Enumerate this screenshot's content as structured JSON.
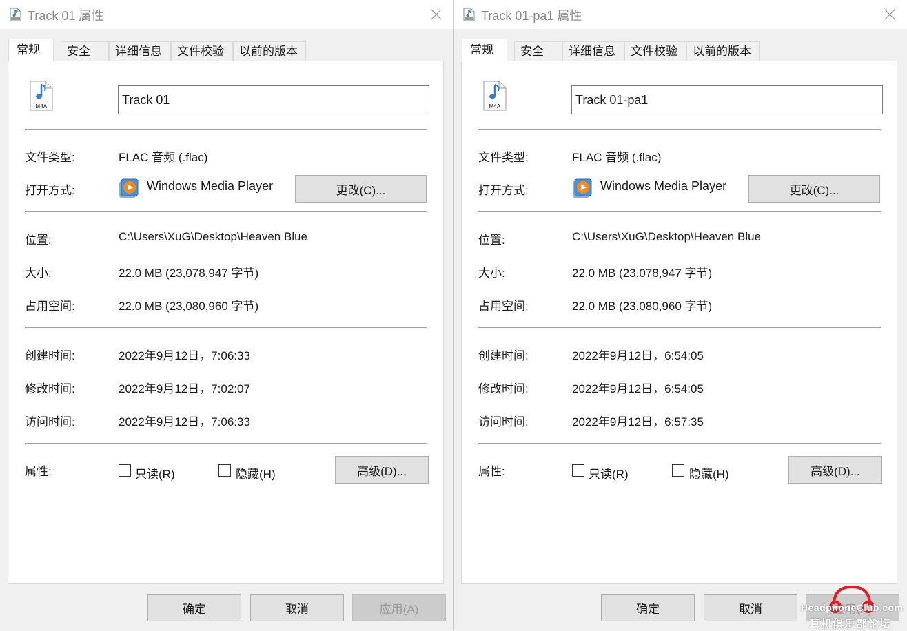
{
  "colors": {
    "watermark_red": "#e31b23",
    "disabled_text": "#9a9a9a"
  },
  "left": {
    "title": "Track 01 属性",
    "tabs": [
      "常规",
      "安全",
      "详细信息",
      "文件校验",
      "以前的版本"
    ],
    "name": "Track 01",
    "file_type_label": "文件类型:",
    "file_type": "FLAC 音频 (.flac)",
    "open_with_label": "打开方式:",
    "open_with_app": "Windows Media Player",
    "change_button": "更改(C)...",
    "location_label": "位置:",
    "location": "C:\\Users\\XuG\\Desktop\\Heaven Blue",
    "size_label": "大小:",
    "size": "22.0 MB (23,078,947 字节)",
    "disk_label": "占用空间:",
    "disk": "22.0 MB (23,080,960 字节)",
    "created_label": "创建时间:",
    "created": "2022年9月12日，7:06:33",
    "modified_label": "修改时间:",
    "modified": "2022年9月12日，7:02:07",
    "accessed_label": "访问时间:",
    "accessed": "2022年9月12日，7:06:33",
    "attributes_label": "属性:",
    "readonly_label": "只读(R)",
    "hidden_label": "隐藏(H)",
    "advanced_button": "高级(D)...",
    "ok_button": "确定",
    "cancel_button": "取消",
    "apply_button": "应用(A)"
  },
  "right": {
    "title": "Track 01-pa1 属性",
    "tabs": [
      "常规",
      "安全",
      "详细信息",
      "文件校验",
      "以前的版本"
    ],
    "name": "Track 01-pa1",
    "file_type_label": "文件类型:",
    "file_type": "FLAC 音频 (.flac)",
    "open_with_label": "打开方式:",
    "open_with_app": "Windows Media Player",
    "change_button": "更改(C)...",
    "location_label": "位置:",
    "location": "C:\\Users\\XuG\\Desktop\\Heaven Blue",
    "size_label": "大小:",
    "size": "22.0 MB (23,078,947 字节)",
    "disk_label": "占用空间:",
    "disk": "22.0 MB (23,080,960 字节)",
    "created_label": "创建时间:",
    "created": "2022年9月12日，6:54:05",
    "modified_label": "修改时间:",
    "modified": "2022年9月12日，6:54:05",
    "accessed_label": "访问时间:",
    "accessed": "2022年9月12日，6:57:35",
    "attributes_label": "属性:",
    "readonly_label": "只读(R)",
    "hidden_label": "隐藏(H)",
    "advanced_button": "高级(D)...",
    "ok_button": "确定",
    "cancel_button": "取消",
    "apply_button": "应用(A)"
  },
  "watermark": {
    "line1": "HeadphoneClub.com",
    "line2": "耳机俱乐部论坛"
  },
  "file_icon_label": "M4A"
}
